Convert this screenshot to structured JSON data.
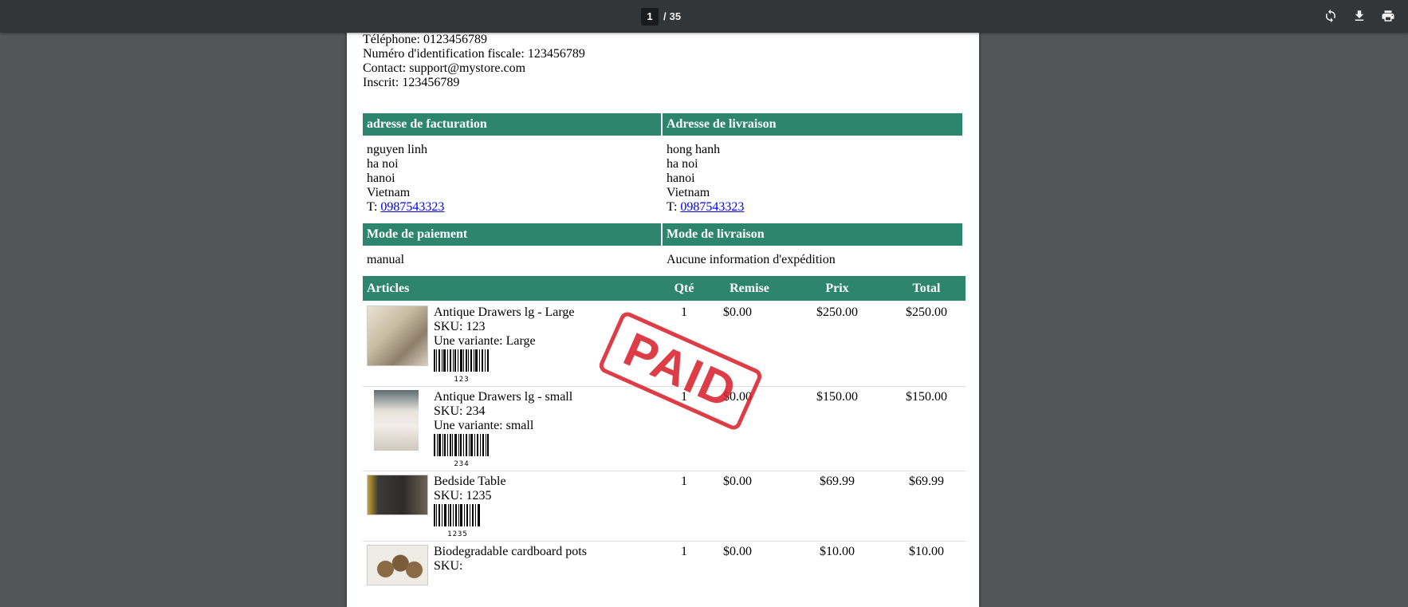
{
  "viewer": {
    "current_page": "1",
    "separator": "/",
    "total_pages": "35",
    "icons": [
      "rotate-icon",
      "download-icon",
      "print-icon"
    ]
  },
  "store": {
    "phone": "Téléphone: 0123456789",
    "tax_id": "Numéro d'identification fiscale: 123456789",
    "contact": "Contact: support@mystore.com",
    "registered": "Inscrit: 123456789"
  },
  "billing": {
    "header": "adresse de facturation",
    "name": "nguyen linh",
    "street": "ha noi",
    "city": "hanoi",
    "country": "Vietnam",
    "phone_prefix": "T:",
    "phone": "0987543323"
  },
  "shipping": {
    "header": "Adresse de livraison",
    "name": "hong hanh",
    "street": "ha noi",
    "city": "hanoi",
    "country": "Vietnam",
    "phone_prefix": "T:",
    "phone": "0987543323"
  },
  "payment": {
    "header": "Mode de paiement",
    "value": "manual"
  },
  "delivery": {
    "header": "Mode de livraison",
    "value": "Aucune information d'expédition"
  },
  "items_table": {
    "columns": [
      "Articles",
      "Qté",
      "Remise",
      "Prix",
      "Total"
    ],
    "rows": [
      {
        "name": "Antique Drawers lg - Large",
        "sku": "SKU: 123",
        "variant": "Une variante: Large",
        "barcode": "123",
        "qty": "1",
        "discount": "$0.00",
        "price": "$250.00",
        "total": "$250.00"
      },
      {
        "name": "Antique Drawers lg - small",
        "sku": "SKU: 234",
        "variant": "Une variante: small",
        "barcode": "234",
        "qty": "1",
        "discount": "$0.00",
        "price": "$150.00",
        "total": "$150.00"
      },
      {
        "name": "Bedside Table",
        "sku": "SKU: 1235",
        "barcode": "1235",
        "qty": "1",
        "discount": "$0.00",
        "price": "$69.99",
        "total": "$69.99"
      },
      {
        "name": "Biodegradable cardboard pots",
        "sku": "SKU:",
        "qty": "1",
        "discount": "$0.00",
        "price": "$10.00",
        "total": "$10.00"
      }
    ]
  },
  "stamp": {
    "text": "PAID",
    "color": "#d9232d"
  },
  "colors": {
    "header_bg": "#2e856e",
    "toolbar_bg": "#323639",
    "viewer_bg": "#525659"
  }
}
